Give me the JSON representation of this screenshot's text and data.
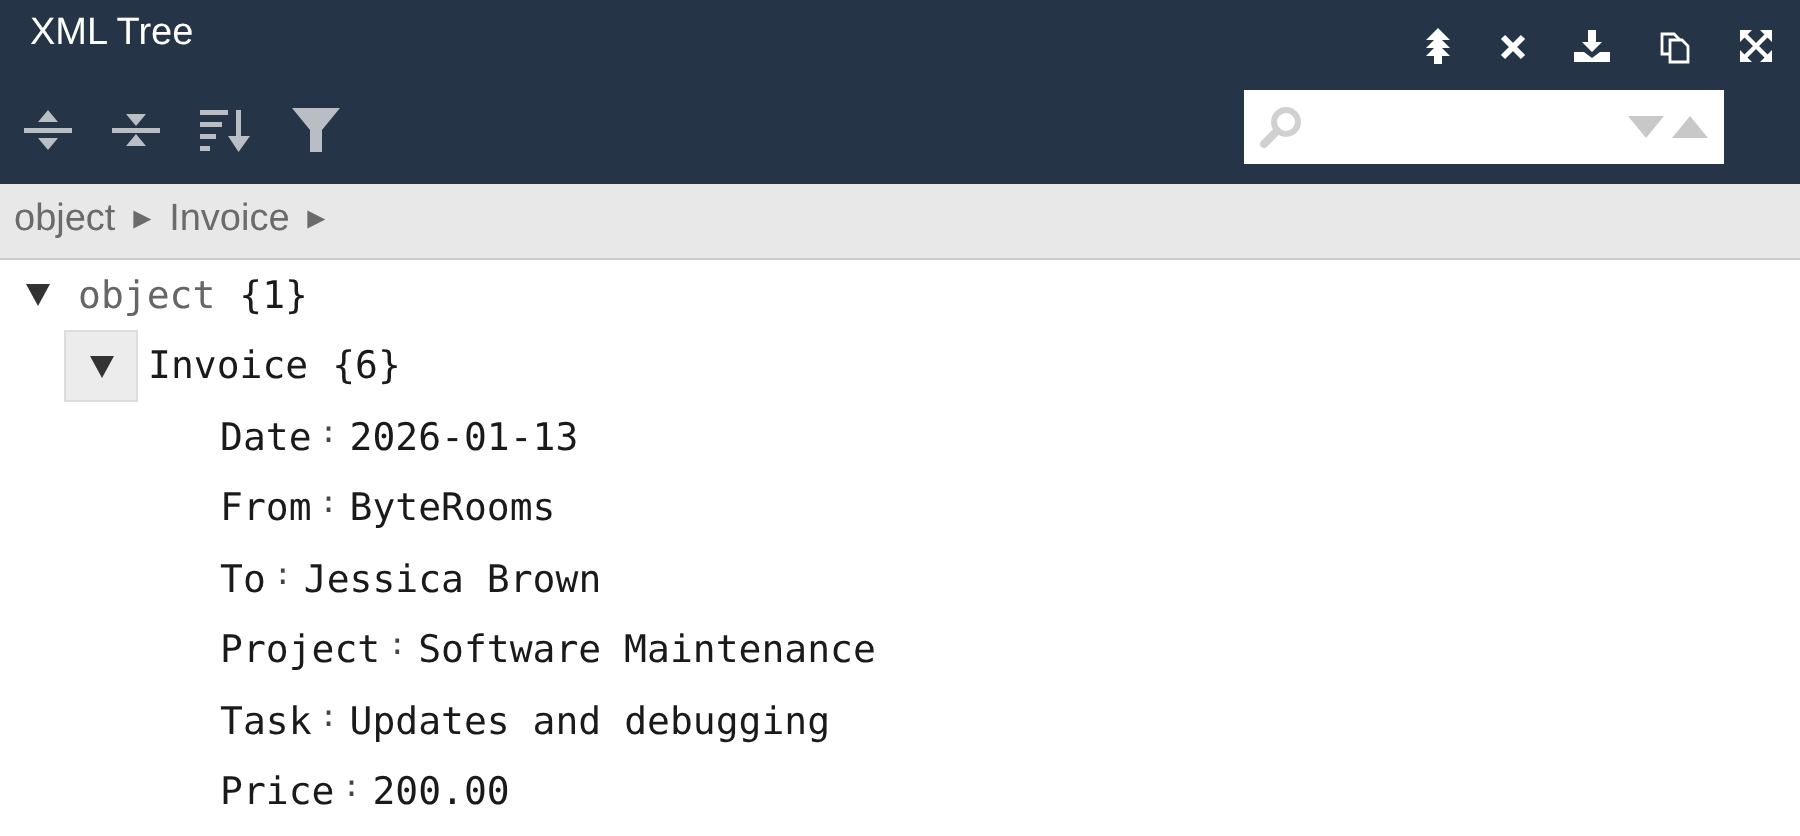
{
  "window": {
    "title": "XML Tree"
  },
  "header_actions": [
    {
      "kind": "collapse-up"
    },
    {
      "kind": "close"
    },
    {
      "kind": "download"
    },
    {
      "kind": "copy"
    },
    {
      "kind": "fullscreen"
    }
  ],
  "toolbar": [
    {
      "kind": "expand-all"
    },
    {
      "kind": "collapse-all"
    },
    {
      "kind": "sort"
    },
    {
      "kind": "filter"
    }
  ],
  "search": {
    "nav": [
      {
        "kind": "next"
      },
      {
        "kind": "previous"
      }
    ]
  },
  "breadcrumb": {
    "separator": "►",
    "items": [
      "object",
      "Invoice"
    ]
  },
  "tree": [
    {
      "label": "object",
      "count": "{1}",
      "expanded": true,
      "hovered": false,
      "children": [
        {
          "label": "Invoice",
          "count": "{6}",
          "expanded": true,
          "hovered": true,
          "fields": [
            {
              "key": "Date",
              "sep": ":",
              "value": "2026-01-13"
            },
            {
              "key": "From",
              "sep": ":",
              "value": "ByteRooms"
            },
            {
              "key": "To",
              "sep": ":",
              "value": "Jessica Brown"
            },
            {
              "key": "Project",
              "sep": ":",
              "value": "Software Maintenance"
            },
            {
              "key": "Task",
              "sep": ":",
              "value": "Updates and debugging"
            },
            {
              "key": "Price",
              "sep": ":",
              "value": "200.00"
            }
          ]
        }
      ]
    }
  ]
}
